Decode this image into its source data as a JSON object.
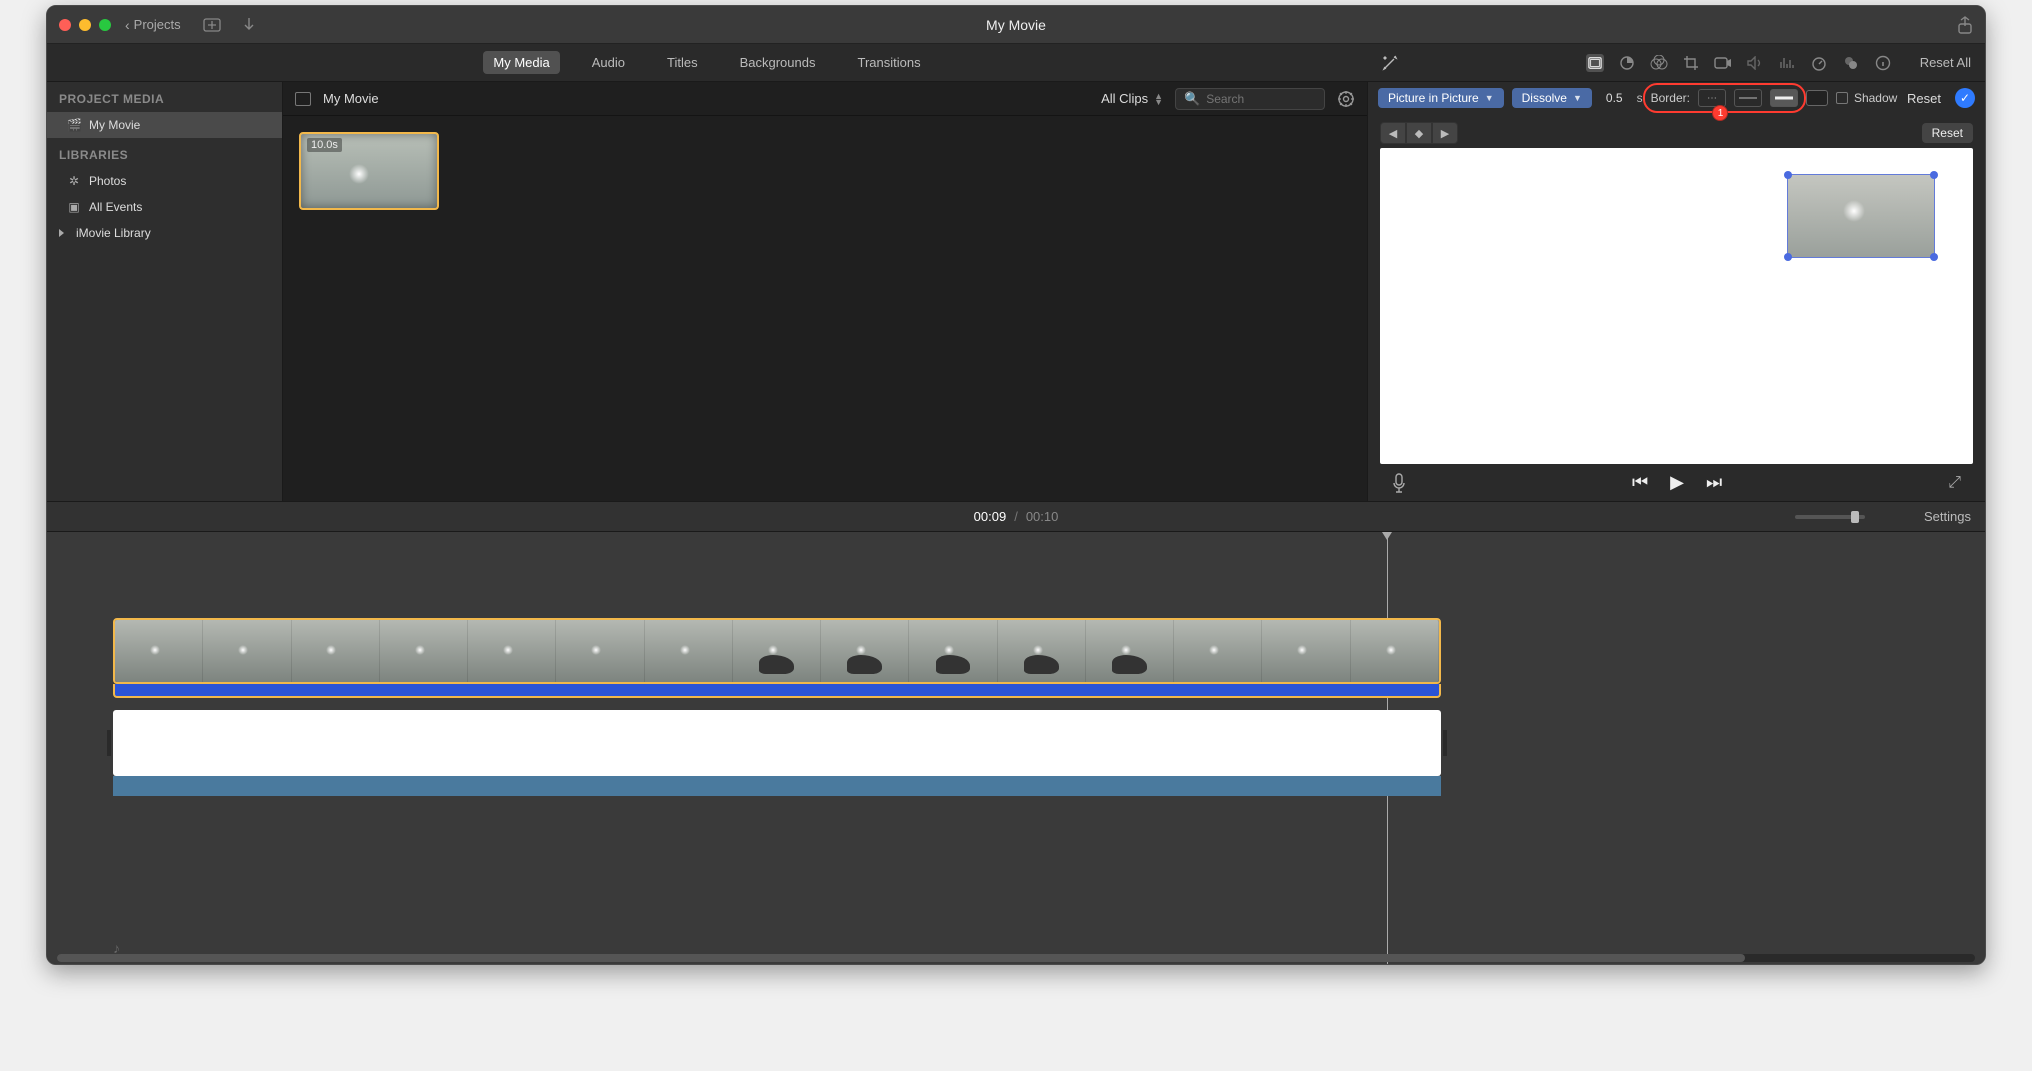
{
  "titlebar": {
    "projects_label": "Projects",
    "window_title": "My Movie"
  },
  "media_tabs": {
    "my_media": "My Media",
    "audio": "Audio",
    "titles": "Titles",
    "backgrounds": "Backgrounds",
    "transitions": "Transitions"
  },
  "inspector_toolbar": {
    "reset_all": "Reset All"
  },
  "sidebar": {
    "project_media_header": "PROJECT MEDIA",
    "project_name": "My Movie",
    "libraries_header": "LIBRARIES",
    "photos": "Photos",
    "all_events": "All Events",
    "imovie_library": "iMovie Library"
  },
  "browser": {
    "title": "My Movie",
    "filter": "All Clips",
    "search_placeholder": "Search",
    "clip_duration": "10.0s"
  },
  "pip": {
    "mode": "Picture in Picture",
    "transition": "Dissolve",
    "duration_value": "0.5",
    "duration_unit": "s",
    "border_label": "Border:",
    "shadow_label": "Shadow",
    "reset_label": "Reset",
    "reset_pill": "Reset",
    "annotation_badge": "1"
  },
  "timeline": {
    "current": "00:09",
    "total": "00:10",
    "settings": "Settings"
  }
}
